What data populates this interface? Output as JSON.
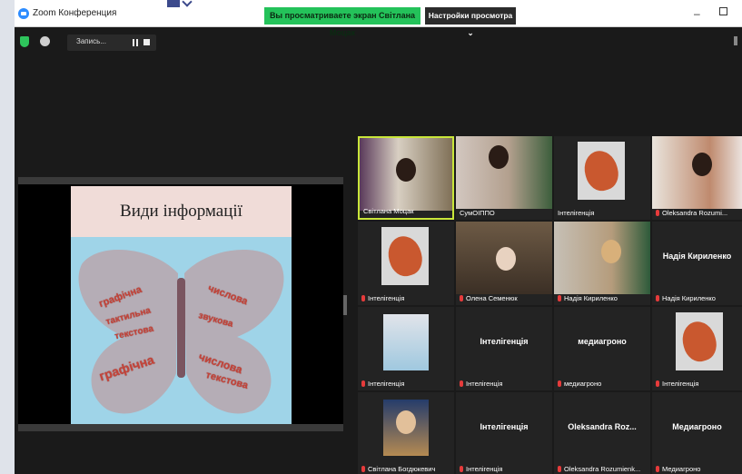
{
  "window": {
    "title": "Zoom Конференция",
    "share_banner": "Вы просматриваете экран Світлана Моцак",
    "view_options": "Настройки просмотра ⌄",
    "minimize_glyph": "–"
  },
  "toolbar": {
    "recording_label": "Запись...",
    "icons": [
      "shield-icon",
      "info-icon",
      "pause-icon",
      "stop-icon"
    ]
  },
  "shared_screen": {
    "slide_title": "Види інформації",
    "slide_words": [
      "графічна",
      "числова",
      "тактильна",
      "текстова",
      "звукова",
      "графічна",
      "числова",
      "текстова"
    ]
  },
  "participants": [
    {
      "name": "Світлана Моцак",
      "type": "video",
      "active": true,
      "muted": false
    },
    {
      "name": "СумОІППО",
      "type": "video",
      "muted": false
    },
    {
      "name": "Інтелігенція",
      "type": "photo",
      "muted": false
    },
    {
      "name": "Oleksandra Rozumi...",
      "type": "video",
      "muted": true
    },
    {
      "name": "Інтелігенція",
      "type": "photo",
      "muted": true
    },
    {
      "name": "Олена Семенюк",
      "type": "video",
      "muted": true
    },
    {
      "name": "Надія Кириленко",
      "type": "video",
      "muted": true
    },
    {
      "name": "Надія Кириленко",
      "type": "text",
      "label": "Надія Кириленко",
      "muted": true
    },
    {
      "name": "Інтелігенція",
      "type": "photo",
      "muted": true
    },
    {
      "name": "Інтелігенція",
      "type": "text",
      "label": "Інтелігенція",
      "muted": true
    },
    {
      "name": "медиагроно",
      "type": "text",
      "label": "медиагроно",
      "muted": true
    },
    {
      "name": "Інтелігенція",
      "type": "photo",
      "muted": true
    },
    {
      "name": "Світлана Богдюкевич",
      "type": "video",
      "muted": true
    },
    {
      "name": "Інтелігенція",
      "type": "text",
      "label": "Інтелігенція",
      "muted": true
    },
    {
      "name": "Oleksandra Rozumienk...",
      "type": "text",
      "label": "Oleksandra Roz...",
      "muted": true
    },
    {
      "name": "Медиагроно",
      "type": "text",
      "label": "Медиагроно",
      "muted": true
    }
  ],
  "colors": {
    "active_speaker_border": "#c9e63a",
    "share_banner_bg": "#24c25a",
    "muted_icon": "#e63b3b"
  }
}
